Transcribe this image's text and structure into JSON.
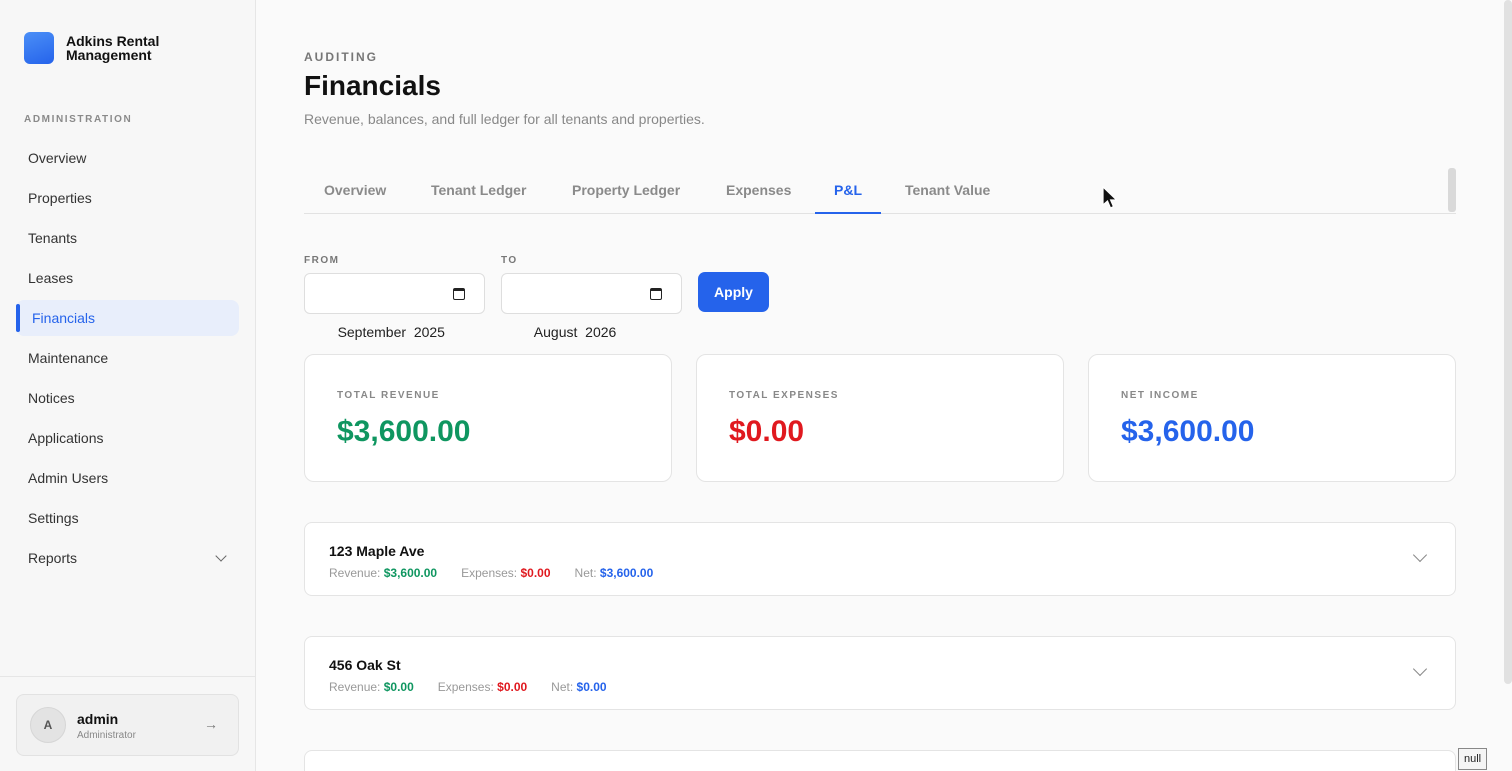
{
  "brand": {
    "name": "Adkins Rental Management"
  },
  "sidebar": {
    "section_label": "ADMINISTRATION",
    "items": [
      {
        "label": "Overview"
      },
      {
        "label": "Properties"
      },
      {
        "label": "Tenants"
      },
      {
        "label": "Leases"
      },
      {
        "label": "Financials",
        "active": true
      },
      {
        "label": "Maintenance"
      },
      {
        "label": "Notices"
      },
      {
        "label": "Applications"
      },
      {
        "label": "Admin Users"
      },
      {
        "label": "Settings"
      },
      {
        "label": "Reports",
        "has_submenu": true
      }
    ],
    "user": {
      "initial": "A",
      "name": "admin",
      "role": "Administrator",
      "logout_icon": "arrow-right-icon"
    }
  },
  "header": {
    "eyebrow": "AUDITING",
    "title": "Financials",
    "subtitle": "Revenue, balances, and full ledger for all tenants and properties."
  },
  "tabs": [
    {
      "label": "Overview"
    },
    {
      "label": "Tenant Ledger"
    },
    {
      "label": "Property Ledger"
    },
    {
      "label": "Expenses"
    },
    {
      "label": "P&L",
      "active": true
    },
    {
      "label": "Tenant Value"
    }
  ],
  "filters": {
    "from_label": "FROM",
    "from_value": "September  2025",
    "to_label": "TO",
    "to_value": "August  2026",
    "apply_label": "Apply"
  },
  "summary": {
    "revenue_label": "TOTAL REVENUE",
    "revenue_value": "$3,600.00",
    "expenses_label": "TOTAL EXPENSES",
    "expenses_value": "$0.00",
    "net_label": "NET INCOME",
    "net_value": "$3,600.00"
  },
  "properties": [
    {
      "name": "123 Maple Ave",
      "revenue_label": "Revenue:",
      "revenue": "$3,600.00",
      "expenses_label": "Expenses:",
      "expenses": "$0.00",
      "net_label": "Net:",
      "net": "$3,600.00"
    },
    {
      "name": "456 Oak St",
      "revenue_label": "Revenue:",
      "revenue": "$0.00",
      "expenses_label": "Expenses:",
      "expenses": "$0.00",
      "net_label": "Net:",
      "net": "$0.00"
    }
  ],
  "overlay": {
    "null_text": "null"
  },
  "colors": {
    "accent": "#2563eb",
    "positive": "#0f9660",
    "negative": "#e0191f"
  }
}
